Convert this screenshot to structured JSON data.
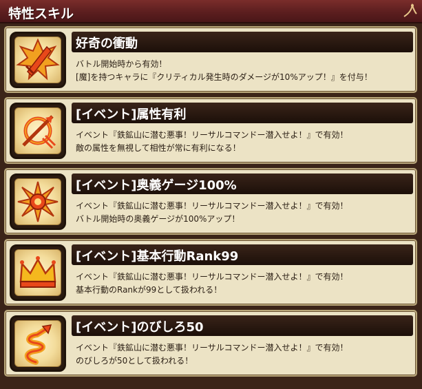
{
  "header": {
    "title": "特性スキル"
  },
  "skills": [
    {
      "icon": "sword-burst-icon",
      "title": "好奇の衝動",
      "lines": [
        "バトル開始時から有効！",
        "[魔]を持つキャラに『クリティカル発生時のダメージが10%アップ！』を付与！"
      ]
    },
    {
      "icon": "crossed-ring-icon",
      "title": "[イベント]属性有利",
      "lines": [
        "イベント『鉄鉱山に潜む悪事！リーサルコマンドー潜入せよ！』で有効！",
        "敵の属性を無視して相性が常に有利になる！"
      ]
    },
    {
      "icon": "starburst-icon",
      "title": "[イベント]奥義ゲージ100%",
      "lines": [
        "イベント『鉄鉱山に潜む悪事！リーサルコマンドー潜入せよ！』で有効！",
        "バトル開始時の奥義ゲージが100%アップ！"
      ]
    },
    {
      "icon": "crown-icon",
      "title": "[イベント]基本行動Rank99",
      "lines": [
        "イベント『鉄鉱山に潜む悪事！リーサルコマンドー潜入せよ！』で有効！",
        "基本行動のRankが99として扱われる！"
      ]
    },
    {
      "icon": "spiral-arrow-icon",
      "title": "[イベント]のびしろ50",
      "lines": [
        "イベント『鉄鉱山に潜む悪事！リーサルコマンドー潜入せよ！』で有効！",
        "のびしろが50として扱われる！"
      ]
    }
  ]
}
